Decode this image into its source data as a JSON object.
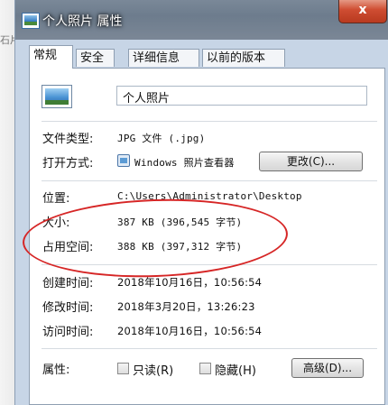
{
  "desktop": {
    "partial_text": "石片"
  },
  "window": {
    "title": "个人照片 属性",
    "close_label": "x"
  },
  "tabs": [
    {
      "label": "常规"
    },
    {
      "label": "安全"
    },
    {
      "label": "详细信息"
    },
    {
      "label": "以前的版本"
    }
  ],
  "general": {
    "file_name": "个人照片",
    "file_type_label": "文件类型:",
    "file_type_value": "JPG 文件 (.jpg)",
    "open_with_label": "打开方式:",
    "open_with_value": "Windows 照片查看器",
    "change_button": "更改(C)...",
    "location_label": "位置:",
    "location_value": "C:\\Users\\Administrator\\Desktop",
    "size_label": "大小:",
    "size_value": "387 KB (396,545 字节)",
    "size_on_disk_label": "占用空间:",
    "size_on_disk_value": "388 KB (397,312 字节)",
    "created_label": "创建时间:",
    "created_value": "2018年10月16日，10:56:54",
    "modified_label": "修改时间:",
    "modified_value": "2018年3月20日，13:26:23",
    "accessed_label": "访问时间:",
    "accessed_value": "2018年10月16日，10:56:54",
    "attributes_label": "属性:",
    "readonly_label": "只读(R)",
    "hidden_label": "隐藏(H)",
    "advanced_button": "高级(D)..."
  },
  "colors": {
    "annotation": "#d62626",
    "close_button": "#cf4d32"
  }
}
